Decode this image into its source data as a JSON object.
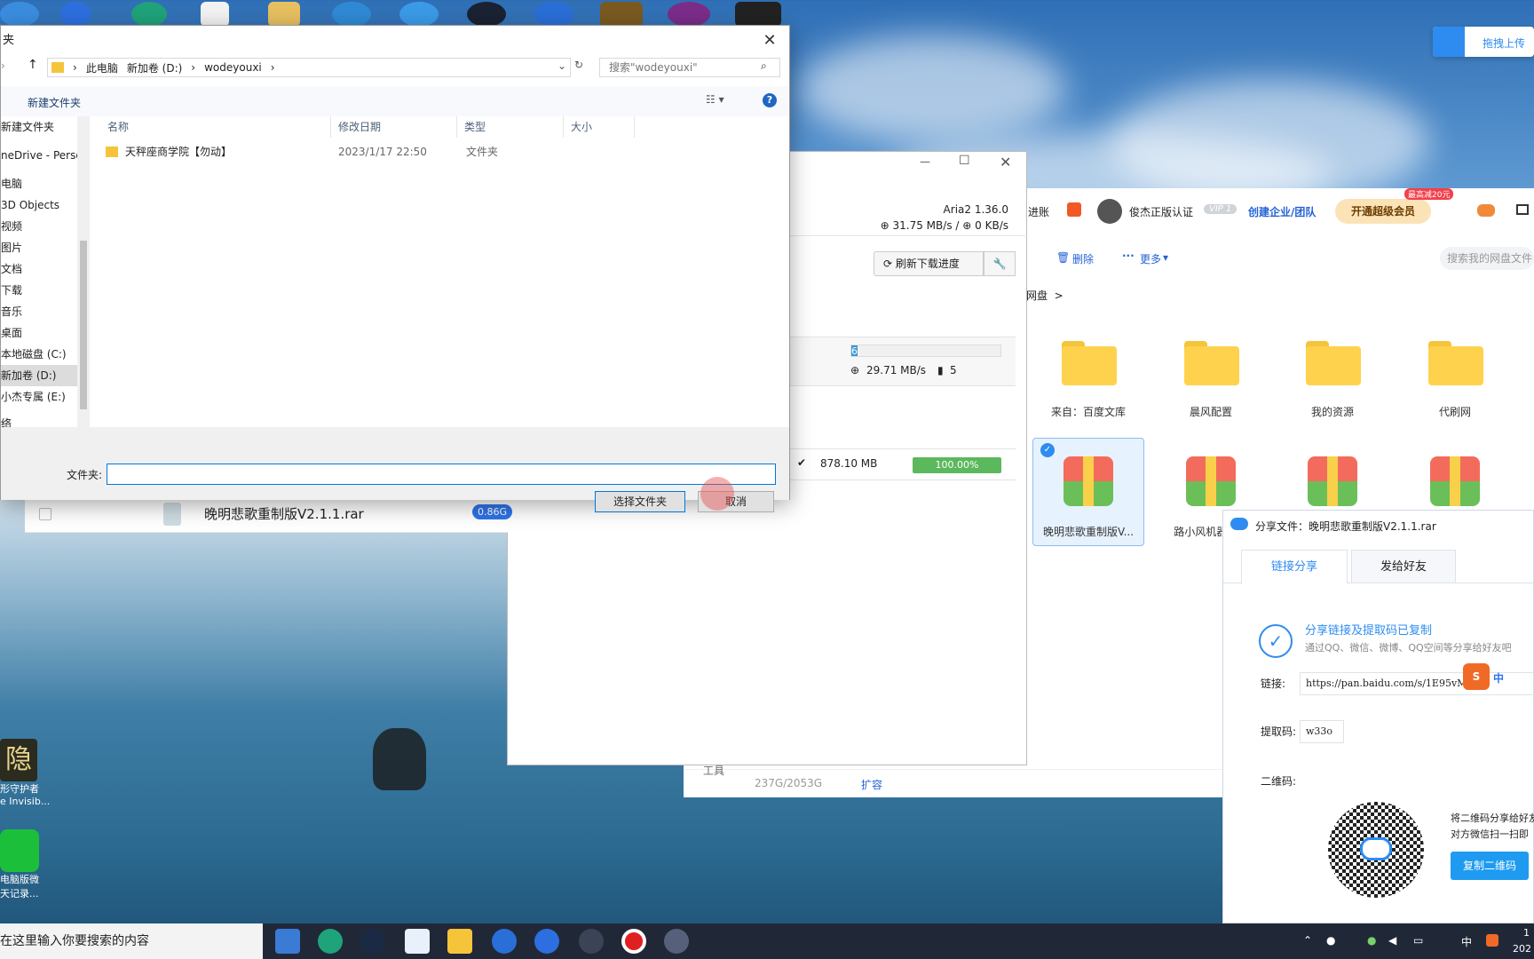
{
  "dialog": {
    "title": "夹",
    "breadcrumb": [
      "此电脑",
      "新加卷 (D:)",
      "wodeyouxi"
    ],
    "search_placeholder": "搜索\"wodeyouxi\"",
    "new_folder": "新建文件夹",
    "nav": [
      "新建文件夹",
      "neDrive - Perso",
      "电脑",
      "3D Objects",
      "视频",
      "图片",
      "文档",
      "下载",
      "音乐",
      "桌面",
      "本地磁盘 (C:)",
      "新加卷 (D:)",
      "小杰专属 (E:)",
      "络"
    ],
    "columns": [
      "名称",
      "修改日期",
      "类型",
      "大小"
    ],
    "file": {
      "name": "天秤座商学院【勿动】",
      "date": "2023/1/17 22:50",
      "type": "文件夹"
    },
    "folder_label": "文件夹:",
    "folder_value": "",
    "select_btn": "选择文件夹",
    "cancel_btn": "取消"
  },
  "aria": {
    "version": "Aria2 1.36.0",
    "speed": "31.75 MB/s / ",
    "upspeed": "0 KB/s",
    "refresh": "刷新下载进度",
    "task_speed": "29.71 MB/s",
    "conn": "5",
    "progress_text": "6.",
    "done_size": "878.10 MB",
    "done_pct": "100.00%",
    "progress_fraction": 0.04
  },
  "list": {
    "file": "晚明悲歌重制版V2.1.1.rar",
    "size": "0.86G"
  },
  "baidu": {
    "upload": "拖拽上传",
    "jinzhang": "进账",
    "user": "俊杰正版认证",
    "vip_badge": "VIP 1",
    "create": "创建企业/团队",
    "open_vip": "开通超级会员",
    "discount": "最高减20元",
    "delete": "删除",
    "more": "更多",
    "search": "搜索我的网盘文件",
    "breadcrumb": "网盘  >",
    "folders": [
      "来自：百度文库",
      "晨风配置",
      "我的资源",
      "代刷网"
    ],
    "files": [
      "晚明悲歌重制版V...",
      "路小风机器人..."
    ],
    "storage": "237G/2053G",
    "expand": "扩容",
    "tools": "工具"
  },
  "share": {
    "title": "分享文件：晚明悲歌重制版V2.1.1.rar",
    "tab1": "链接分享",
    "tab2": "发给好友",
    "success": "分享链接及提取码已复制",
    "desc": "通过QQ、微信、微博、QQ空间等分享给好友吧",
    "link_label": "链接:",
    "link": "https://pan.baidu.com/s/1E95vM",
    "code_label": "提取码:",
    "code": "w33o",
    "qr_label": "二维码:",
    "qr_desc1": "将二维码分享给好友",
    "qr_desc2": "对方微信扫一扫即",
    "copy_qr": "复制二维码"
  },
  "desktop": {
    "icon1": "形守护者",
    "icon1b": "e Invisib...",
    "icon2": "电脑版微",
    "icon2b": "天记录..."
  },
  "taskbar": {
    "search": "在这里输入你要搜索的内容",
    "ime": "中",
    "time": "1",
    "date": "202"
  }
}
